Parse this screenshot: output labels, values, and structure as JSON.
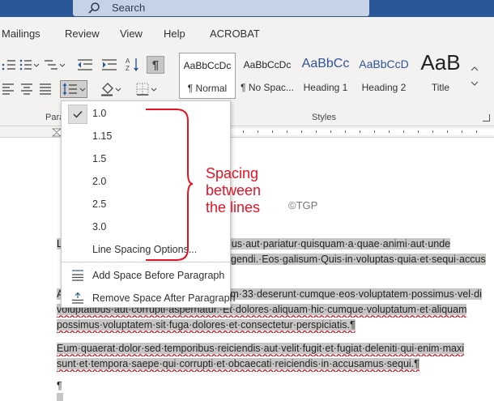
{
  "title_bar": {
    "search_label": "Search"
  },
  "ribbon": {
    "tabs": [
      "Mailings",
      "Review",
      "View",
      "Help",
      "ACROBAT"
    ],
    "group_labels": {
      "paragraph": "Para",
      "styles": "Styles"
    },
    "styles": [
      {
        "sample": "AaBbCcDc",
        "name": "¶ Normal"
      },
      {
        "sample": "AaBbCcDc",
        "name": "¶ No Spac..."
      },
      {
        "sample": "AaBbCc",
        "name": "Heading 1"
      },
      {
        "sample": "AaBbCcD",
        "name": "Heading 2"
      },
      {
        "sample": "AaB",
        "name": "Title"
      }
    ]
  },
  "line_spacing_menu": {
    "options": [
      "1.0",
      "1.15",
      "1.5",
      "2.0",
      "2.5",
      "3.0"
    ],
    "selected_value": "1.0",
    "more_options_label": "Line Spacing Options...",
    "add_before_label": "Add Space Before Paragraph",
    "remove_after_label": "Remove Space After Paragraph"
  },
  "annotation": {
    "line1": "Spacing",
    "line2": "between",
    "line3": "the lines"
  },
  "watermark": "©TGP",
  "document": {
    "p1": [
      "L",
      "trum·eius·aut·pariatur·quisquam·a·quae·animi·aut·unde",
      "gendi.·Eos·galisum·Quis·in·voluptas·quia·et·sequi·accus"
    ],
    "p2": [
      "A",
      "m·33·deserunt·cumque·eos·voluptatem·possimus·vel·di",
      "voluptatibus·aut·corrupti·aspernatur.·Et·dolores·aliquam·hic·cumque·voluptatum·et·aliquam",
      "possimus·voluptatem·sit·fuga·dolores·et·consectetur·perspiciatis.¶"
    ],
    "p3": [
      "Eum·quaerat·dolor·sed·temporibus·reiciendis·aut·velit·fugit·et·fugiat·deleniti·qui·enim·maxi",
      "sunt·et·tempora·saepe·qui·corrupti·et·obcaecati·reiciendis·in·accusamus·sequi.¶"
    ],
    "pilcrow": "¶"
  },
  "colors": {
    "title_bar": "#2b579a",
    "ribbon": "#f3f2f1",
    "selection": "#c8c6c4",
    "annotation": "#e81123"
  }
}
